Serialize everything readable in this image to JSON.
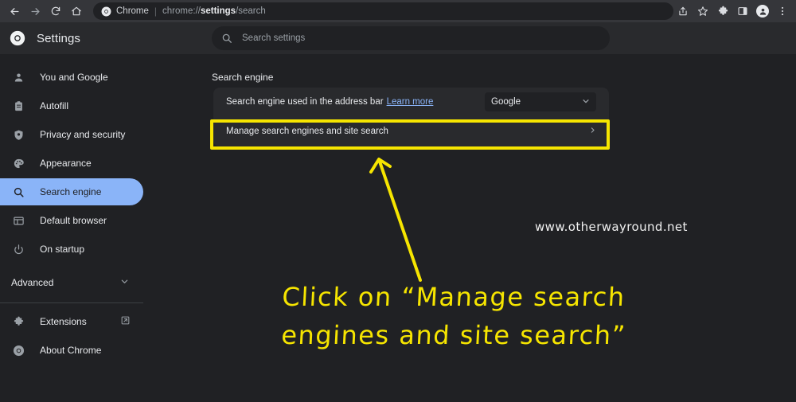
{
  "browser": {
    "back_icon": "back-arrow-icon",
    "forward_icon": "forward-arrow-icon",
    "reload_icon": "reload-icon",
    "home_icon": "home-icon",
    "omnibox": {
      "chip_label": "Chrome",
      "url_prefix": "chrome://",
      "url_bold": "settings",
      "url_suffix": "/search"
    },
    "right_icons": [
      {
        "name": "share-icon",
        "label": "Share"
      },
      {
        "name": "bookmark-star-icon",
        "label": "Bookmark this tab"
      },
      {
        "name": "extensions-puzzle-icon",
        "label": "Extensions"
      },
      {
        "name": "side-panel-icon",
        "label": "Side panel"
      },
      {
        "name": "profile-avatar-icon",
        "label": "Profile"
      },
      {
        "name": "three-dot-menu-icon",
        "label": "Customize and control Google Chrome"
      }
    ]
  },
  "header": {
    "logo": "chrome-logo-icon",
    "title": "Settings",
    "search": {
      "icon": "search-icon",
      "placeholder": "Search settings",
      "value": ""
    }
  },
  "sidebar": {
    "items": [
      {
        "label": "You and Google",
        "icon": "person-icon",
        "selected": false
      },
      {
        "label": "Autofill",
        "icon": "clipboard-icon",
        "selected": false
      },
      {
        "label": "Privacy and security",
        "icon": "shield-icon",
        "selected": false
      },
      {
        "label": "Appearance",
        "icon": "palette-icon",
        "selected": false
      },
      {
        "label": "Search engine",
        "icon": "magnifier-icon",
        "selected": true
      },
      {
        "label": "Default browser",
        "icon": "browser-window-icon",
        "selected": false
      },
      {
        "label": "On startup",
        "icon": "power-icon",
        "selected": false
      }
    ],
    "advanced": {
      "label": "Advanced",
      "icon": "chevron-down-icon"
    },
    "footer": [
      {
        "label": "Extensions",
        "icon": "puzzle-icon",
        "trailing_icon": "external-link-icon"
      },
      {
        "label": "About Chrome",
        "icon": "chrome-logo-icon",
        "trailing_icon": ""
      }
    ]
  },
  "main": {
    "section_title": "Search engine",
    "rows": [
      {
        "label": "Search engine used in the address bar",
        "link_label": "Learn more",
        "select_value": "Google",
        "select_icon": "chevron-down-icon"
      },
      {
        "label": "Manage search engines and site search",
        "trailing_icon": "chevron-right-icon"
      }
    ]
  },
  "annotation": {
    "highlight_color": "#f6e500",
    "arrow": "yellow-arrow-icon",
    "line1": "Click on “Manage search",
    "line2": "engines and site search”",
    "watermark": "www.otherwayround.net"
  }
}
